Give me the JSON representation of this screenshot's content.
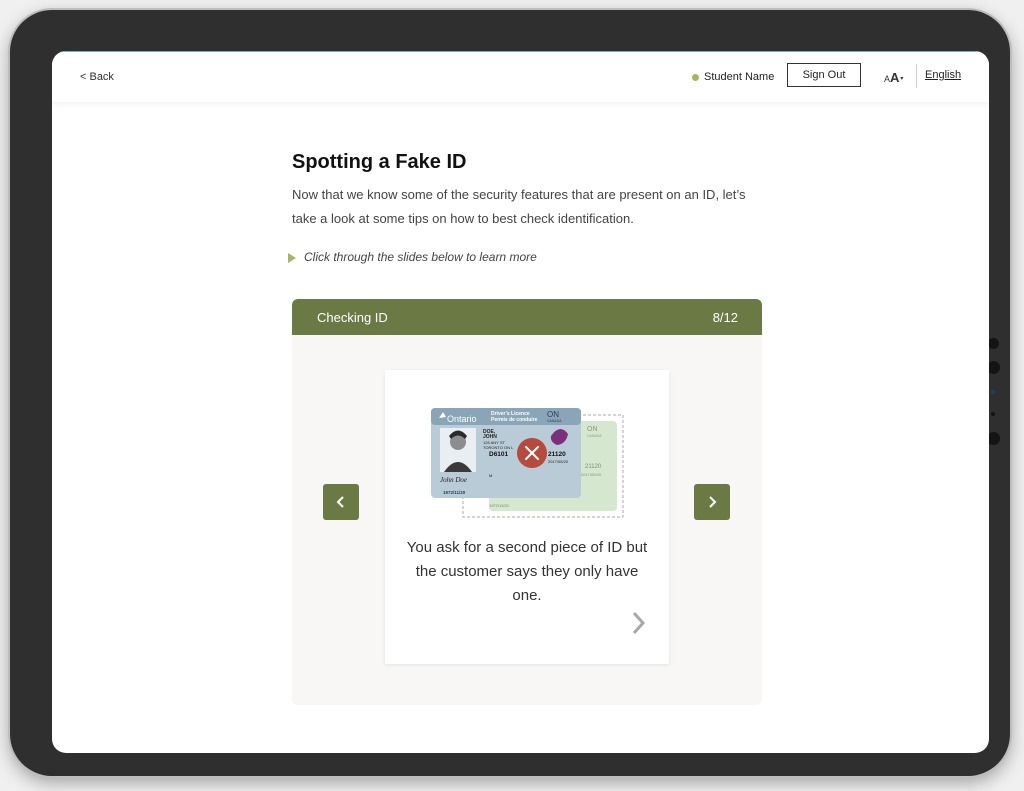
{
  "header": {
    "back_label": "< Back",
    "student_name": "Student Name",
    "sign_out_label": "Sign Out",
    "font_size_small": "A",
    "font_size_big": "A",
    "font_size_caret": "▾",
    "language_label": "English",
    "status_color": "#a9b565"
  },
  "main": {
    "title": "Spotting a Fake ID",
    "intro": "Now that we know some of the security features that are present on an ID, let’s take a look at some tips on how to best check identification.",
    "hint": "Click through the slides below to learn more"
  },
  "carousel": {
    "title": "Checking ID",
    "counter": "8/12",
    "accent_color": "#6b7a45",
    "slide": {
      "text": "You ask for a second piece of ID but the customer says they only have one.",
      "illustration": {
        "front_card": {
          "province": "Ontario",
          "heading_en": "Driver’s Licence",
          "heading_fr": "Permis de conduire",
          "code": "ON",
          "country": "CANADA",
          "name_last": "DOE,",
          "name_first": "JOHN",
          "address_1": "126 ANY ST",
          "address_2": "TORONTO  ON  L",
          "licence_no": "D6101",
          "exp_code": "21120",
          "issued": "2017/05/20",
          "sex": "M",
          "dob": "1972/11/20",
          "signature": "John Doe",
          "overlay_icon": "x-reject-icon"
        },
        "back_card": {
          "code": "ON",
          "country": "CANADA",
          "exp_code": "21120",
          "issued": "2017/05/20",
          "dob": "1972/11/20"
        }
      }
    }
  }
}
